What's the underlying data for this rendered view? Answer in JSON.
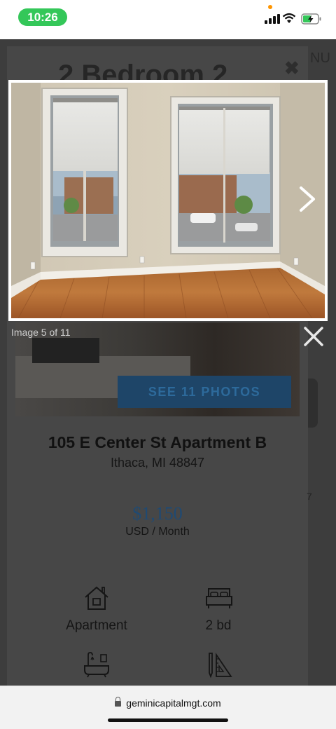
{
  "status_bar": {
    "time": "10:26"
  },
  "background_page": {
    "title_fragment": "2 Bedroom 2",
    "menu_fragment": "NU",
    "see_photos_label": "SEE 11 PHOTOS",
    "address_line1": "105 E Center St Apartment B",
    "address_line2": "Ithaca, MI 48847",
    "price": "$1,150",
    "price_period": "USD / Month",
    "side_text": "7",
    "features": [
      {
        "icon": "house-icon",
        "label": "Apartment"
      },
      {
        "icon": "bed-icon",
        "label": "2 bd"
      },
      {
        "icon": "bathtub-icon",
        "label": ""
      },
      {
        "icon": "ruler-pencil-icon",
        "label": ""
      }
    ]
  },
  "lightbox": {
    "image_counter": "Image 5 of 11",
    "current_index": 5,
    "total_images": 11
  },
  "browser": {
    "url": "geminicapitalmgt.com"
  },
  "colors": {
    "time_pill": "#34c759",
    "price": "#1f4a73",
    "button": "#1e4568"
  }
}
